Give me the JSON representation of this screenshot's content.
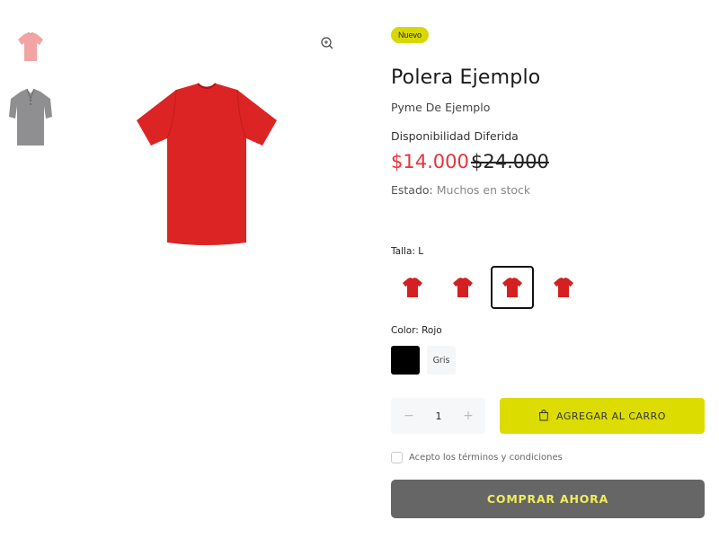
{
  "product": {
    "badge": "Nuevo",
    "title": "Polera Ejemplo",
    "vendor": "Pyme De Ejemplo",
    "availability": "Disponibilidad Diferida",
    "price": "$14.000",
    "compare_price": "$24.000",
    "stock_label": "Estado:",
    "stock_value": "Muchos en stock"
  },
  "gallery": {
    "thumbnails": [
      {
        "name": "pink-tshirt",
        "color": "#f2a3a3"
      },
      {
        "name": "gray-polo",
        "color": "#8f8f92"
      }
    ],
    "main_color": "#dd2424",
    "zoom_icon": "zoom-in-icon"
  },
  "options": {
    "size_label": "Talla: L",
    "sizes_color": "#d42020",
    "size_count_visible": 4,
    "color_label": "Color: Rojo",
    "color_gris": "Gris"
  },
  "cart": {
    "quantity": "1",
    "minus": "−",
    "plus": "+",
    "add_label": "AGREGAR AL CARRO",
    "terms": "Acepto los términos y condiciones",
    "buy_now": "COMPRAR AHORA"
  },
  "colors": {
    "accent": "#dcdc00",
    "price": "#e8323c",
    "buy_bg": "#666666",
    "buy_text": "#f2ed5a"
  }
}
